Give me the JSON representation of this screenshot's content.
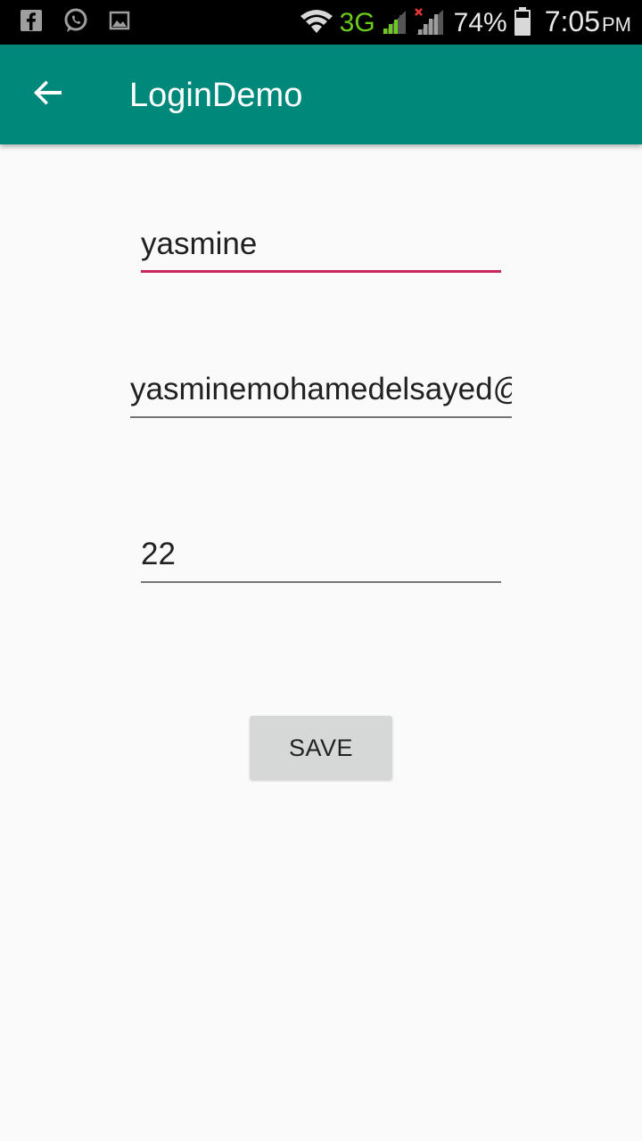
{
  "status_bar": {
    "network_type": "3G",
    "battery_percent": "74%",
    "time": "7:05",
    "ampm": "PM",
    "notification_icons": [
      "facebook-icon",
      "whatsapp-icon",
      "image-icon"
    ],
    "system_icons": [
      "wifi-icon",
      "signal-icon",
      "signal-no-service-icon",
      "battery-icon"
    ]
  },
  "app_bar": {
    "title": "LoginDemo",
    "nav_icon": "arrow-back-icon",
    "background_color": "#00897b"
  },
  "form": {
    "name_value": "yasmine",
    "email_value": "yasminemohamedelsayed@",
    "age_value": "22",
    "save_label": "SAVE"
  },
  "colors": {
    "focus_underline": "#c9265f",
    "idle_underline": "#757575",
    "button_bg": "#d6d7d7"
  }
}
